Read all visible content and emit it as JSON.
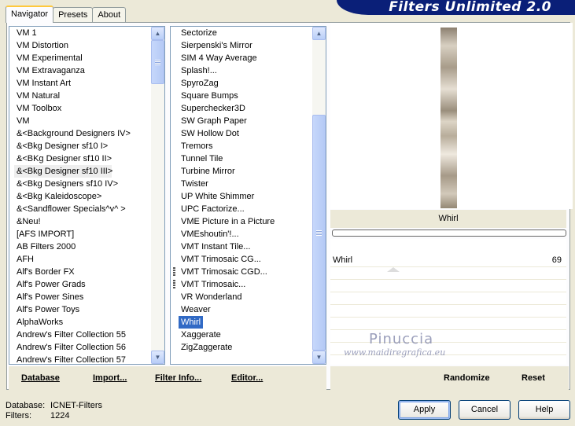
{
  "window": {
    "title": "Filters Unlimited 2.0"
  },
  "tabs": [
    {
      "label": "Navigator",
      "active": true
    },
    {
      "label": "Presets",
      "active": false
    },
    {
      "label": "About",
      "active": false
    }
  ],
  "categories": {
    "items": [
      "VM 1",
      "VM Distortion",
      "VM Experimental",
      "VM Extravaganza",
      "VM Instant Art",
      "VM Natural",
      "VM Toolbox",
      "VM",
      "&<Background Designers IV>",
      "&<Bkg Designer sf10 I>",
      "&<BKg Designer sf10 II>",
      "&<Bkg Designer sf10 III>",
      "&<Bkg Designers sf10 IV>",
      "&<Bkg Kaleidoscope>",
      "&<Sandflower Specials^v^ >",
      "&Neu!",
      "[AFS IMPORT]",
      "AB Filters 2000",
      "AFH",
      "Alf's Border FX",
      "Alf's Power Grads",
      "Alf's Power Sines",
      "Alf's Power Toys",
      "AlphaWorks",
      "Andrew's Filter Collection 55",
      "Andrew's Filter Collection 56",
      "Andrew's Filter Collection 57"
    ],
    "highlighted": "&<Bkg Designer sf10 III>"
  },
  "filters": {
    "items": [
      "Sectorize",
      "Sierpenski's Mirror",
      "SIM 4 Way Average",
      "Splash!...",
      "SpyroZag",
      "Square Bumps",
      "Superchecker3D",
      "SW Graph Paper",
      "SW Hollow Dot",
      "Tremors",
      "Tunnel Tile",
      "Turbine Mirror",
      "Twister",
      "UP White Shimmer",
      "UPC Factorize...",
      "VME Picture in a Picture",
      "VMEshoutin'!...",
      "VMT Instant Tile...",
      "VMT Trimosaic CG...",
      "VMT Trimosaic CGD...",
      "VMT Trimosaic...",
      "VR Wonderland",
      "Weaver",
      "Whirl",
      "Xaggerate",
      "ZigZaggerate"
    ],
    "selected": "Whirl",
    "marked": [
      "VMT Trimosaic CGD...",
      "VMT Trimosaic..."
    ]
  },
  "preview": {
    "filter_name": "Whirl"
  },
  "params": [
    {
      "label": "Whirl",
      "value": "69"
    }
  ],
  "watermark": {
    "name": "Pinuccia",
    "url": "www.maidiregrafica.eu"
  },
  "bottom_left": {
    "database": "Database",
    "import": "Import...",
    "filter_info": "Filter Info...",
    "editor": "Editor..."
  },
  "bottom_right": {
    "randomize": "Randomize",
    "reset": "Reset"
  },
  "status": {
    "database_label": "Database:",
    "database_value": "ICNET-Filters",
    "filters_label": "Filters:",
    "filters_value": "1224"
  },
  "buttons": {
    "apply": "Apply",
    "cancel": "Cancel",
    "help": "Help"
  }
}
